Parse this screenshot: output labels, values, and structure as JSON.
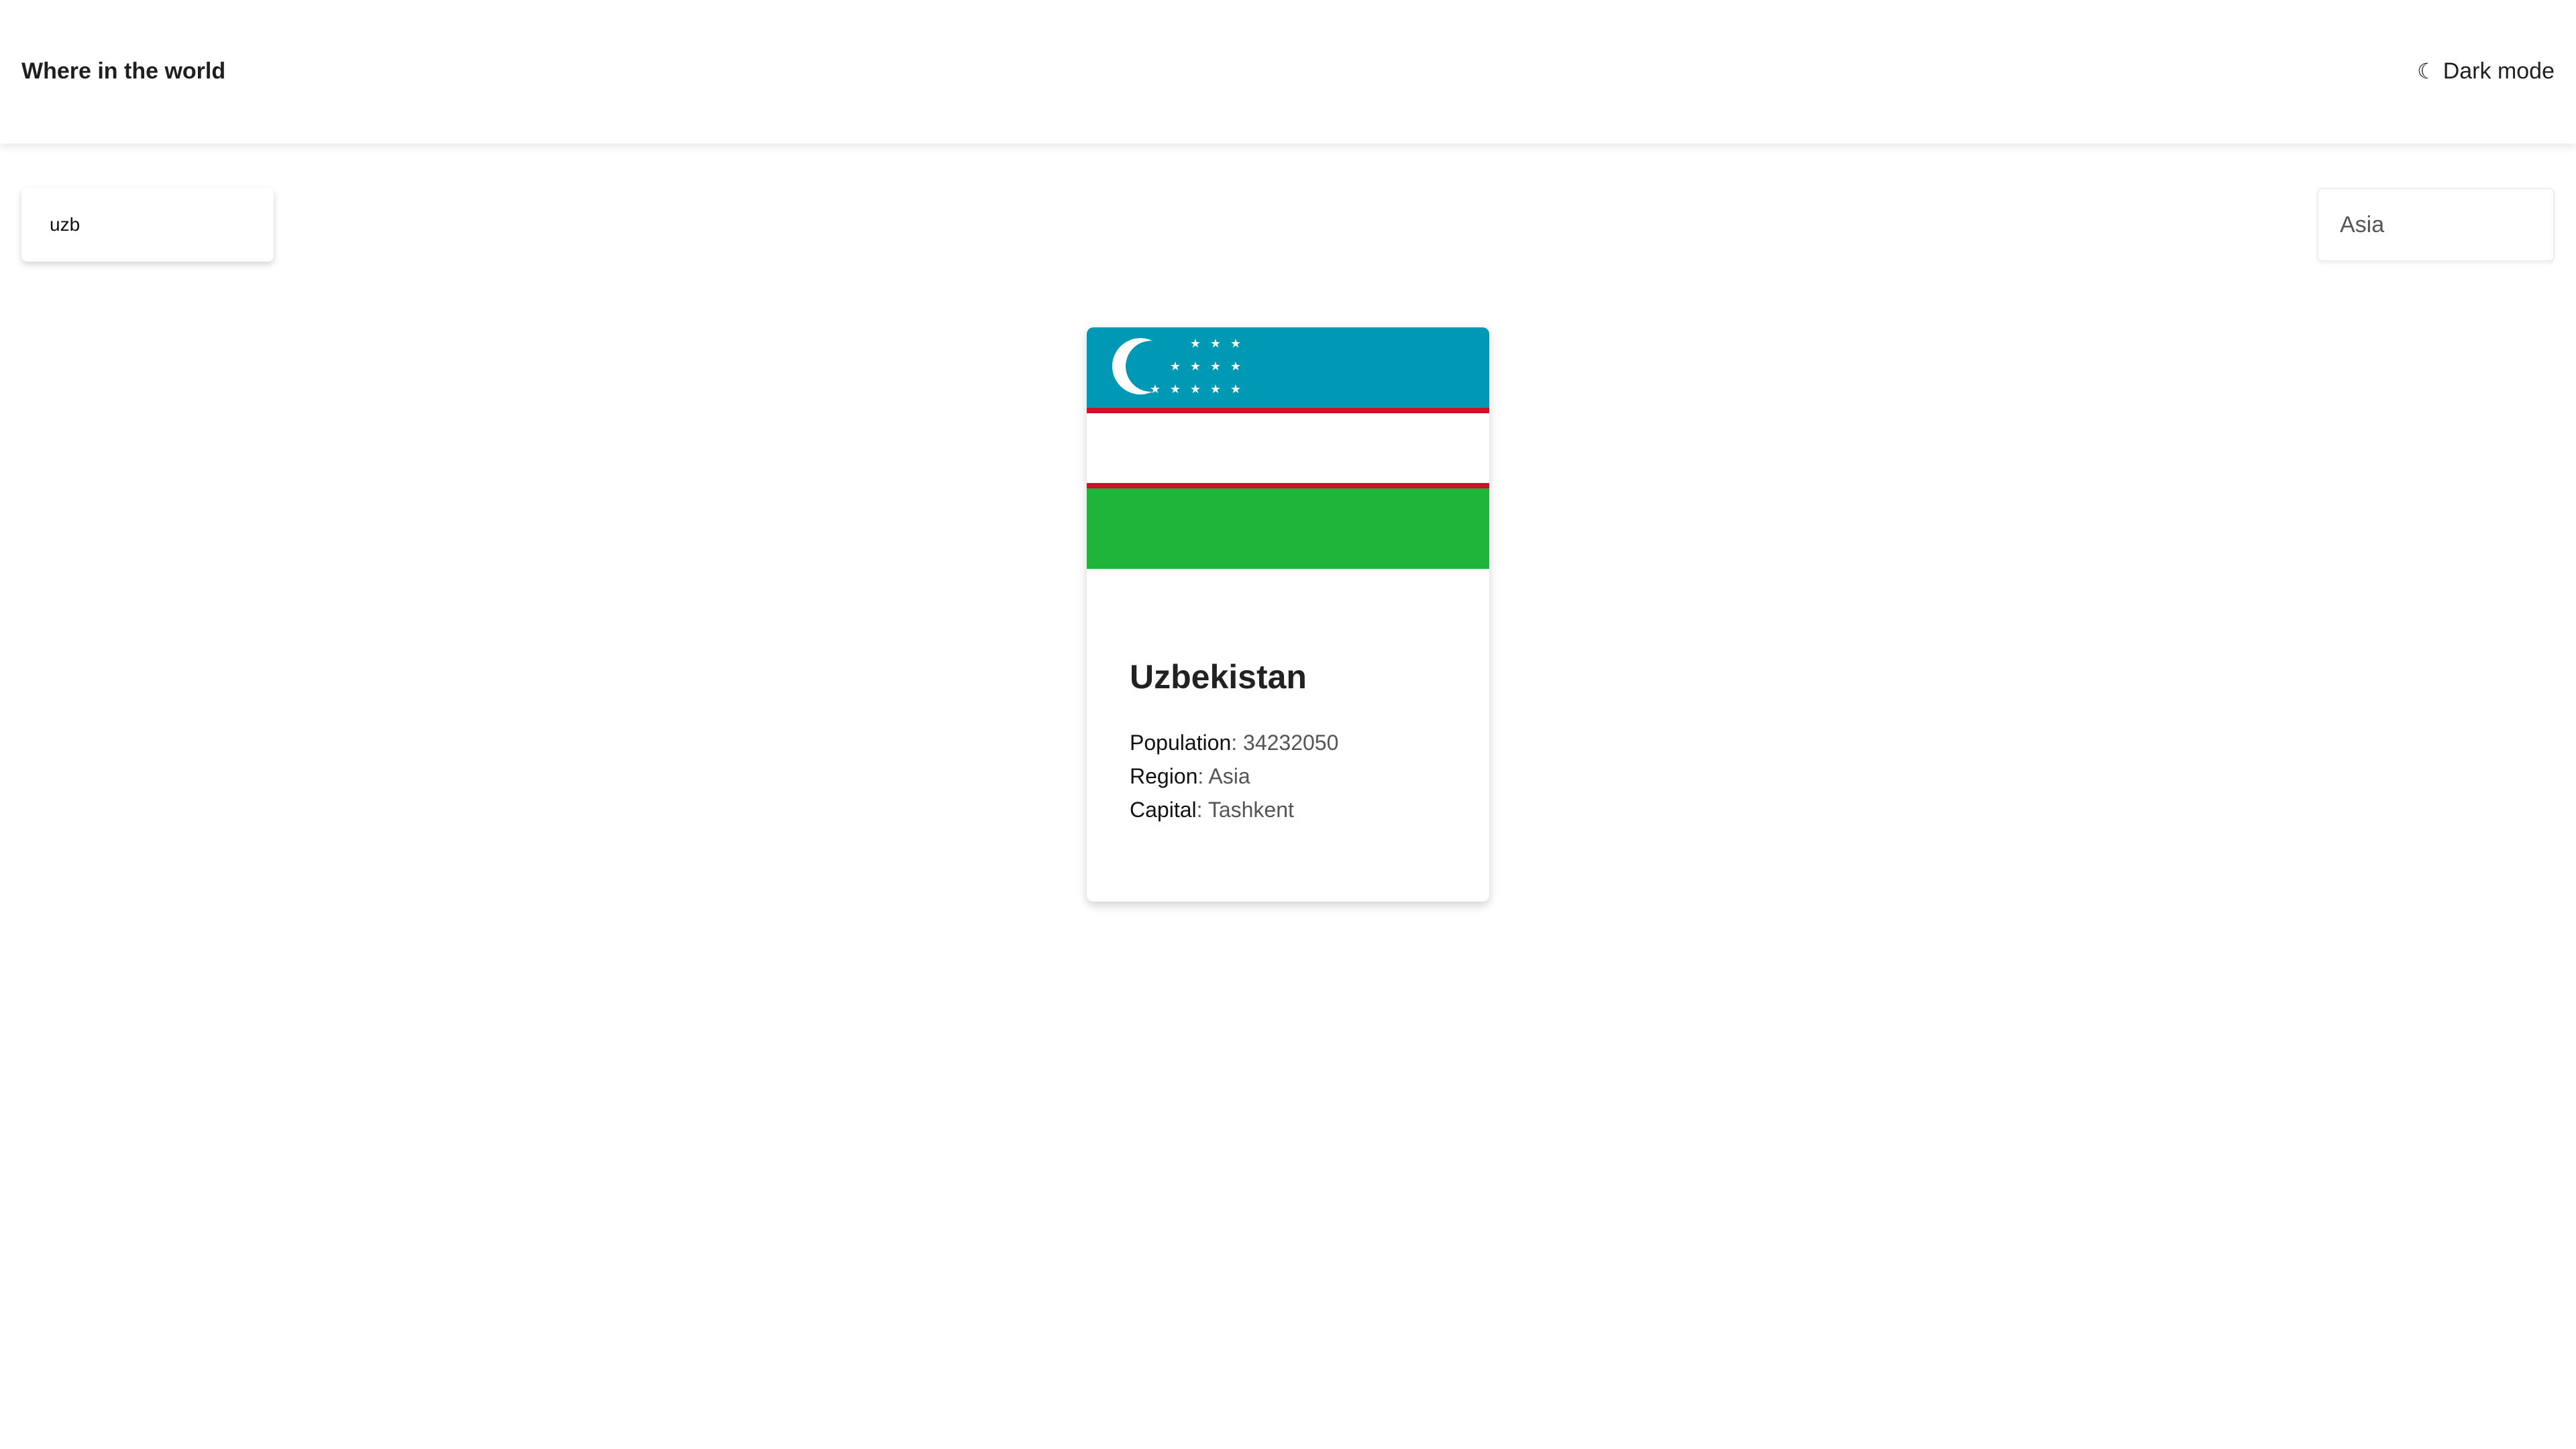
{
  "header": {
    "title": "Where in the world",
    "theme_toggle_label": "Dark mode",
    "theme_toggle_icon": "moon-icon"
  },
  "search": {
    "value": "uzb",
    "icon": "none"
  },
  "filter": {
    "selected_region": "Asia"
  },
  "countries": [
    {
      "name": "Uzbekistan",
      "population_label": "Population",
      "population": "34232050",
      "region_label": "Region",
      "region": "Asia",
      "capital_label": "Capital",
      "capital": "Tashkent",
      "flag": {
        "name": "uzbekistan-flag",
        "colors": {
          "blue": "#0099B5",
          "white": "#FFFFFF",
          "red": "#CE1126",
          "green": "#1EB53A"
        }
      }
    }
  ]
}
